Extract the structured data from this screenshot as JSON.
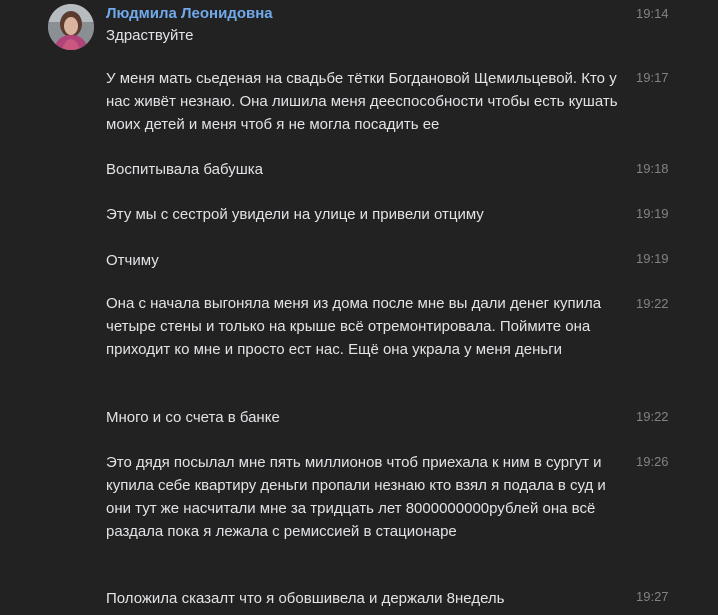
{
  "sender": {
    "name": "Людмила Леонидовна"
  },
  "messages": [
    {
      "text": "Здраствуйте",
      "time": "19:14"
    },
    {
      "text": "У меня мать сьеденая на свадьбе тётки Богдановой Щемильцевой. Кто у нас живёт незнаю. Она лишила меня дееспособности чтобы есть кушать моих детей и меня чтоб я не могла посадить ее",
      "time": "19:17"
    },
    {
      "text": "Воспитывала бабушка",
      "time": "19:18"
    },
    {
      "text": "Эту мы с сестрой увидели на улице и привели отциму",
      "time": "19:19"
    },
    {
      "text": "Отчиму",
      "time": "19:19"
    },
    {
      "text": "Она с начала выгоняла меня из дома после мне вы дали денег купила четыре стены и только на крыше всё отремонтировала. Поймите она приходит ко мне и просто ест нас. Ещё она украла у меня деньги",
      "time": "19:22"
    },
    {
      "text": "Много и со счета в банке",
      "time": "19:22"
    },
    {
      "text": "Это дядя посылал мне пять миллионов чтоб приехала к ним в сургут и купила себе квартиру деньги пропали незнаю кто взял я подала в суд и они тут же насчитали мне за тридцать лет 8000000000рублей она всё раздала пока я лежала с ремиссией в стационаре",
      "time": "19:26"
    },
    {
      "text": "Положила сказалт что я обовшивела и держали 8недель",
      "time": "19:27"
    }
  ]
}
